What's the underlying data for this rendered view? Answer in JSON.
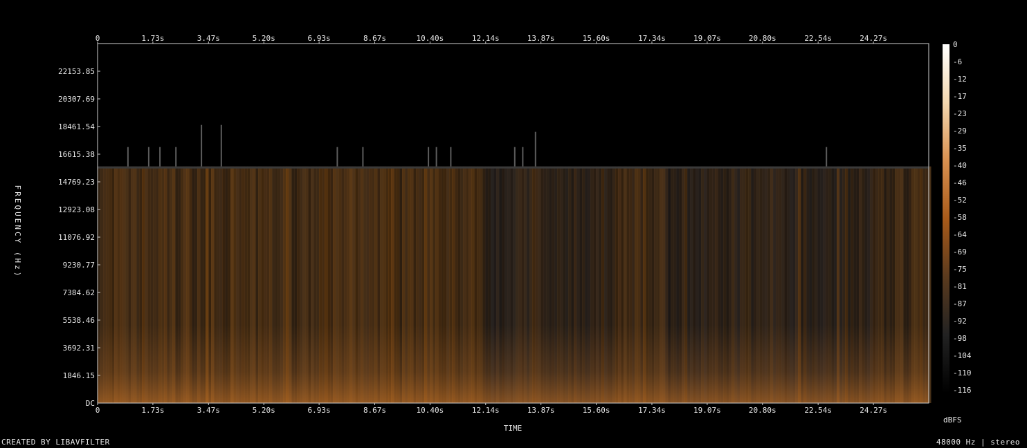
{
  "chart_data": {
    "type": "heatmap",
    "title": "",
    "xlabel": "TIME",
    "ylabel": "FREQUENCY (Hz)",
    "x_ticks": [
      "0",
      "1.73s",
      "3.47s",
      "5.20s",
      "6.93s",
      "8.67s",
      "10.40s",
      "12.14s",
      "13.87s",
      "15.60s",
      "17.34s",
      "19.07s",
      "20.80s",
      "22.54s",
      "24.27s"
    ],
    "x_tick_seconds": [
      0,
      1.73,
      3.47,
      5.2,
      6.93,
      8.67,
      10.4,
      12.14,
      13.87,
      15.6,
      17.34,
      19.07,
      20.8,
      22.54,
      24.27
    ],
    "y_ticks": [
      "DC",
      "1846.15",
      "3692.31",
      "5538.46",
      "7384.62",
      "9230.77",
      "11076.92",
      "12923.08",
      "14769.23",
      "16615.38",
      "18461.54",
      "20307.69",
      "22153.85"
    ],
    "y_tick_hz": [
      0,
      1846.15,
      3692.31,
      5538.46,
      7384.62,
      9230.77,
      11076.92,
      12923.08,
      14769.23,
      16615.38,
      18461.54,
      20307.69,
      22153.85
    ],
    "xlim": [
      0,
      26.0
    ],
    "ylim": [
      0,
      24000
    ],
    "colorbar": {
      "label": "dBFS",
      "ticks": [
        "0",
        "-6",
        "-12",
        "-17",
        "-23",
        "-29",
        "-35",
        "-40",
        "-46",
        "-52",
        "-58",
        "-64",
        "-69",
        "-75",
        "-81",
        "-87",
        "-92",
        "-98",
        "-104",
        "-110",
        "-116"
      ],
      "range": [
        -120,
        0
      ],
      "colors": [
        "#000000",
        "#222222",
        "#5a3a1e",
        "#a85a1a",
        "#d89050",
        "#f4d8b0",
        "#ffffff"
      ]
    },
    "cutoff_hz": 15800,
    "transient_times_s": [
      0.95,
      1.6,
      1.95,
      2.45,
      3.25,
      3.87,
      7.5,
      8.3,
      10.35,
      10.6,
      11.05,
      13.05,
      13.3,
      13.7,
      22.8
    ],
    "grid": false
  },
  "footer": {
    "left": "CREATED BY LIBAVFILTER",
    "right": "48000 Hz | stereo"
  }
}
